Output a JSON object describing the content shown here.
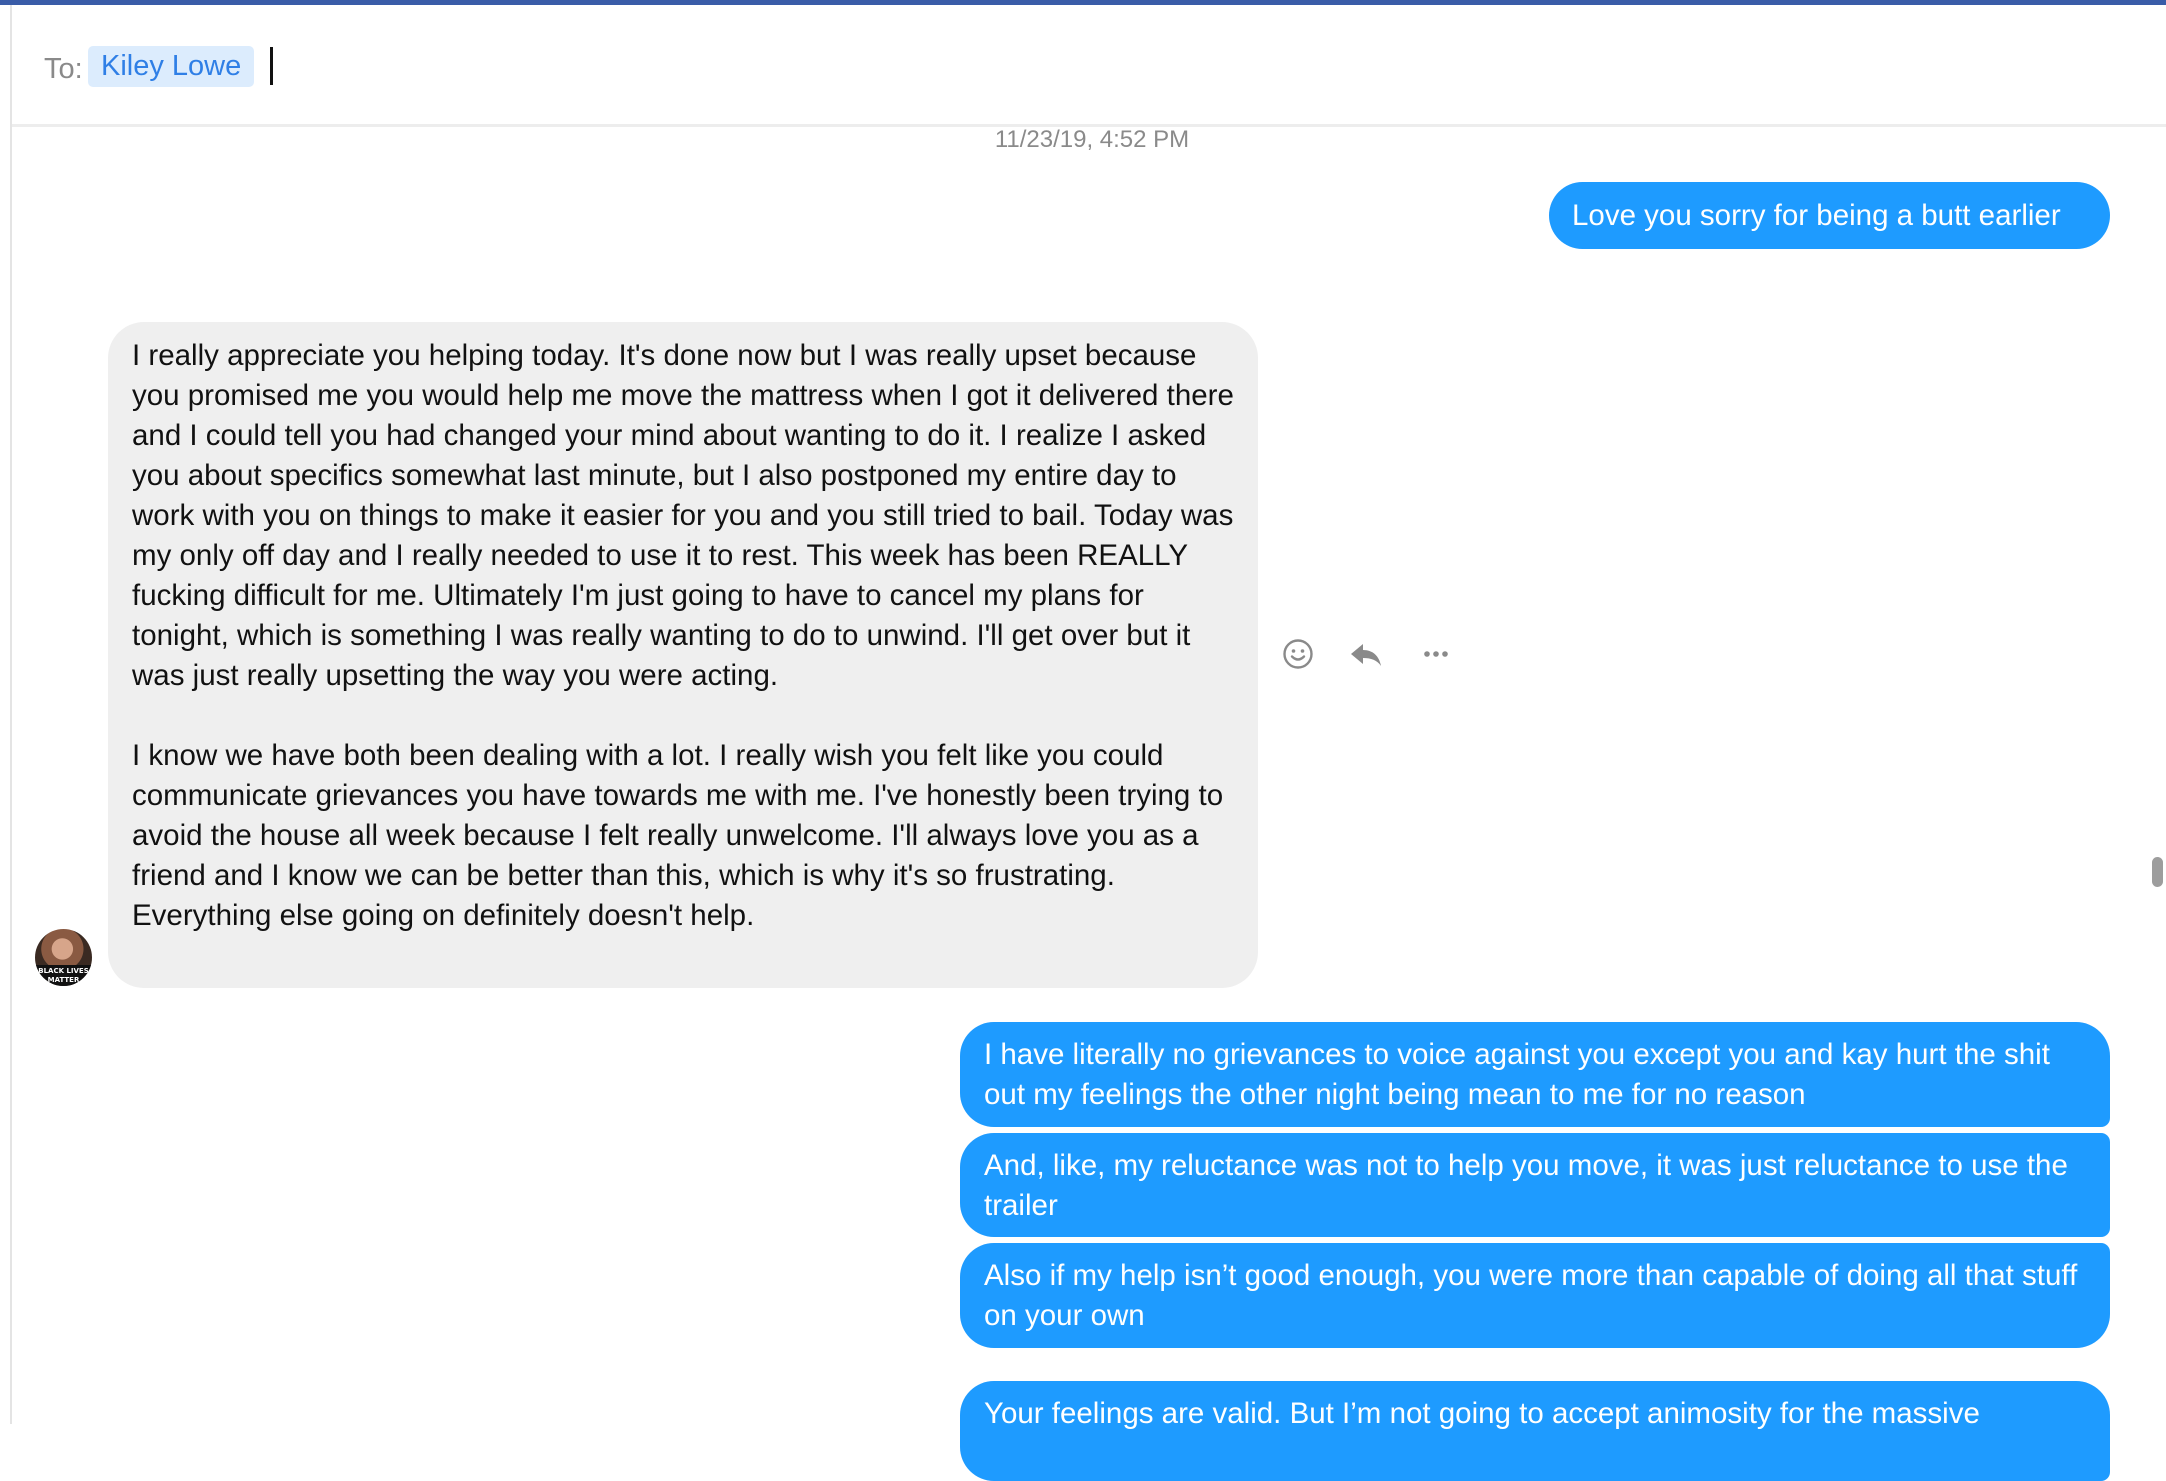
{
  "compose": {
    "to_label": "To:",
    "recipient": "Kiley Lowe"
  },
  "conversation": {
    "timestamp": "11/23/19, 4:52 PM",
    "messages": [
      {
        "direction": "outgoing",
        "text": "Love you sorry for being a butt earlier"
      },
      {
        "direction": "incoming",
        "text": "I really appreciate you helping today. It's done now but I was really upset because you promised me you would help me move the mattress when I got it delivered there and I could tell you had changed your mind about wanting to do it. I realize I asked you about specifics somewhat last minute, but I also postponed my entire day to work with you on things to make it easier for you and you still tried to bail. Today was my only off day and I really needed to use it to rest. This week has been REALLY fucking difficult for me. Ultimately I'm just going to have to cancel my plans for tonight, which is something I was really wanting to do to unwind. I'll get over but it was just really upsetting the way you were acting.\n\nI know we have both been dealing with a lot. I really wish you felt like you could communicate grievances you have towards me with me. I've honestly been trying to avoid the house all week because I felt really unwelcome. I'll always love you as a friend and I know we can be better than this, which is why it's so frustrating. Everything else going on definitely doesn't help.",
        "avatar_text": "BLACK LIVES MATTER"
      },
      {
        "direction": "outgoing",
        "text": "I have literally no grievances to voice against you except you and kay hurt the shit out my feelings the other night being mean to me for no reason"
      },
      {
        "direction": "outgoing",
        "text": "And, like, my reluctance was not to help you move, it was just reluctance to use the trailer"
      },
      {
        "direction": "outgoing",
        "text": "Also if my help isn’t good enough, you were more than capable of doing all that stuff on your own"
      },
      {
        "direction": "outgoing",
        "text": "Your feelings are valid. But I’m not going to accept animosity for the massive"
      }
    ]
  },
  "message_actions": {
    "icons": [
      "smiley-icon",
      "reply-icon",
      "more-icon"
    ]
  },
  "colors": {
    "outgoing_bubble": "#1e9bff",
    "incoming_bubble": "#efefef",
    "recipient_chip": "#dcecfd",
    "recipient_text": "#2f7fe6"
  }
}
